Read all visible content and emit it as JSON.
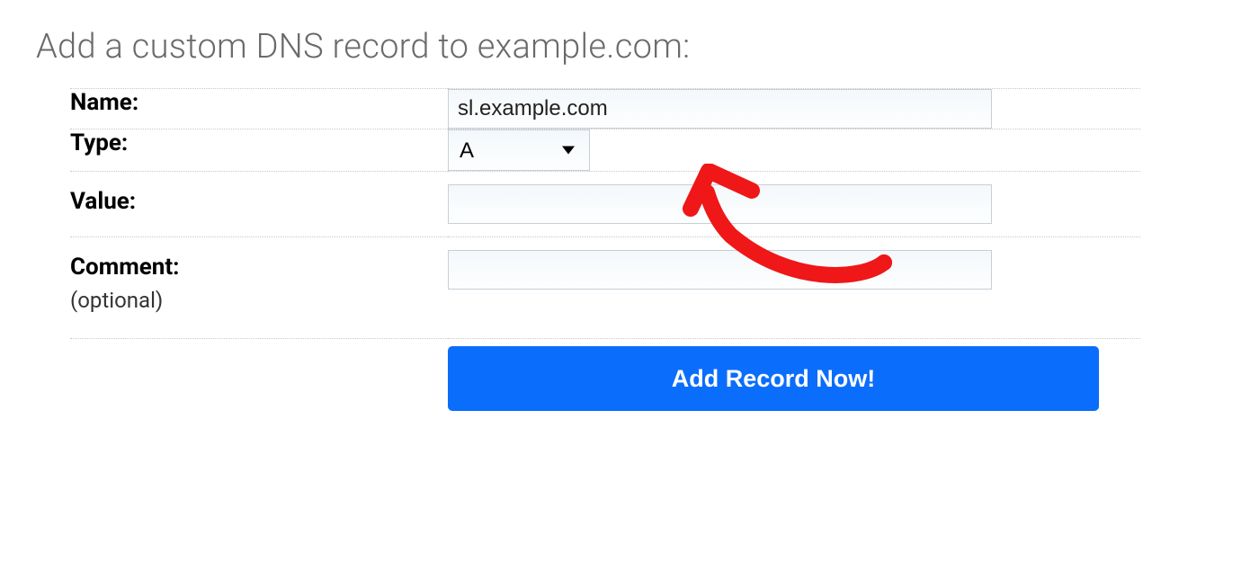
{
  "heading": "Add a custom DNS record to example.com:",
  "form": {
    "name": {
      "label": "Name:",
      "value": "sl.example.com"
    },
    "type": {
      "label": "Type:",
      "selected": "A"
    },
    "value_field": {
      "label": "Value:",
      "value": ""
    },
    "comment": {
      "label": "Comment:",
      "optional_text": "(optional)",
      "value": ""
    },
    "submit_label": "Add Record Now!"
  }
}
